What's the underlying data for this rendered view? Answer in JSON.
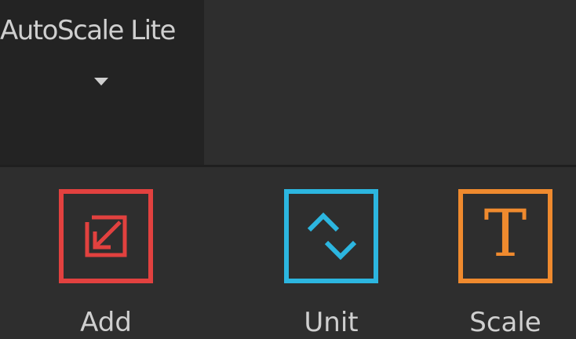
{
  "plugin": {
    "title": "AutoScale Lite"
  },
  "tools": [
    {
      "label": "Add",
      "icon": "add-resize-icon",
      "color": "#e2413f"
    },
    {
      "label": "Unit",
      "icon": "unit-chevrons-icon",
      "color": "#2cb6e0"
    },
    {
      "label": "Scale",
      "icon": "text-t-icon",
      "glyph": "T",
      "color": "#ef8a2e"
    }
  ],
  "theme": {
    "background": "#2e2e2e",
    "tab_background": "#232323",
    "text_color": "#cfcfcf"
  }
}
